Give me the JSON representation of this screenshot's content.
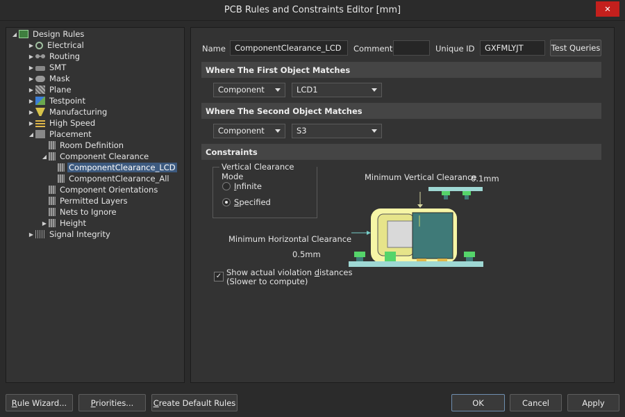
{
  "window": {
    "title": "PCB Rules and Constraints Editor [mm]",
    "close_glyph": "✕"
  },
  "tree": {
    "items": [
      {
        "label": "Design Rules",
        "icon": "design-rules-icon"
      },
      {
        "label": "Electrical",
        "icon": "electrical-icon"
      },
      {
        "label": "Routing",
        "icon": "routing-icon"
      },
      {
        "label": "SMT",
        "icon": "smt-icon"
      },
      {
        "label": "Mask",
        "icon": "mask-icon"
      },
      {
        "label": "Plane",
        "icon": "plane-icon"
      },
      {
        "label": "Testpoint",
        "icon": "testpoint-icon"
      },
      {
        "label": "Manufacturing",
        "icon": "manufacturing-icon"
      },
      {
        "label": "High Speed",
        "icon": "high-speed-icon"
      },
      {
        "label": "Placement",
        "icon": "placement-icon"
      },
      {
        "label": "Room Definition",
        "icon": "room-definition-icon"
      },
      {
        "label": "Component Clearance",
        "icon": "component-clearance-icon"
      },
      {
        "label": "ComponentClearance_LCD",
        "icon": "rule-icon"
      },
      {
        "label": "ComponentClearance_All",
        "icon": "rule-icon"
      },
      {
        "label": "Component Orientations",
        "icon": "component-orientations-icon"
      },
      {
        "label": "Permitted Layers",
        "icon": "permitted-layers-icon"
      },
      {
        "label": "Nets to Ignore",
        "icon": "nets-to-ignore-icon"
      },
      {
        "label": "Height",
        "icon": "height-icon"
      },
      {
        "label": "Signal Integrity",
        "icon": "signal-integrity-icon"
      }
    ]
  },
  "form": {
    "name_label": "Name",
    "name_value": "ComponentClearance_LCD",
    "comment_label": "Comment",
    "comment_value": "",
    "uid_label": "Unique ID",
    "uid_value": "GXFMLYJT",
    "test_queries": "Test Queries"
  },
  "first_match": {
    "header": "Where The First Object Matches",
    "type": "Component",
    "value": "LCD1"
  },
  "second_match": {
    "header": "Where The Second Object Matches",
    "type": "Component",
    "value": "S3"
  },
  "constraints": {
    "header": "Constraints",
    "mode_legend": "Vertical Clearance Mode",
    "infinite_prefix": "I",
    "infinite_rest": "nfinite",
    "specified_prefix": "S",
    "specified_rest": "pecified",
    "selected_mode": "Specified",
    "min_vertical_label": "Minimum Vertical Clearance",
    "min_vertical_value": "0.1mm",
    "min_horizontal_label": "Minimum Horizontal Clearance",
    "min_horizontal_value": "0.5mm",
    "show_violations_pre": "Show actual violation ",
    "show_violations_u": "d",
    "show_violations_post": "istances",
    "show_violations_line2": "(Slower to compute)",
    "show_violations_checked": true
  },
  "footer": {
    "rule_wizard_u": "R",
    "rule_wizard_rest": "ule Wizard...",
    "priorities_u": "P",
    "priorities_rest": "riorities...",
    "create_default_u": "C",
    "create_default_rest": "reate Default Rules",
    "ok": "OK",
    "cancel": "Cancel",
    "apply": "Apply"
  },
  "colors": {
    "accent_selected": "#3d5a7f",
    "diagram_yellow": "#f6f5a6",
    "diagram_teal": "#3f7a78",
    "diagram_green": "#55d46a",
    "diagram_board": "#9fd8d4"
  }
}
